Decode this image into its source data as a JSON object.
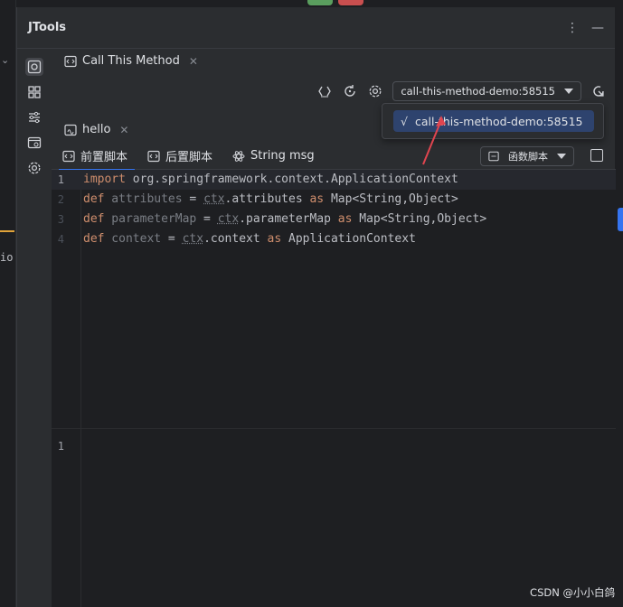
{
  "left_gutter": {
    "fragment": "io"
  },
  "tool_window": {
    "title": "JTools",
    "actions": {
      "more": "⋮",
      "minimize": "—"
    }
  },
  "tabs": {
    "call": {
      "label": "Call This Method"
    },
    "hello": {
      "label": "hello"
    }
  },
  "toolbar": {
    "connection_value": "call-this-method-demo:58515"
  },
  "popup": {
    "items": [
      {
        "label": "call-this-method-demo:58515",
        "check": "√"
      }
    ]
  },
  "subtabs": [
    {
      "label": "前置脚本"
    },
    {
      "label": "后置脚本"
    },
    {
      "label": "String msg"
    }
  ],
  "function_select": {
    "value": "函数脚本"
  },
  "editor": {
    "lines": [
      {
        "no": "1"
      },
      {
        "no": "2"
      },
      {
        "no": "3"
      },
      {
        "no": "4"
      }
    ],
    "tokens": {
      "import": "import",
      "import_target": " org.springframework.context.ApplicationContext",
      "def": "def",
      "attributes": " attributes",
      "parameterMap": " parameterMap",
      "context": " context",
      "eq": " = ",
      "ctx": "ctx",
      "dot_attributes": ".attributes ",
      "dot_parameterMap": ".parameterMap ",
      "dot_context": ".context ",
      "as": "as",
      "map_type": " Map<String,Object>",
      "app_ctx_type": " ApplicationContext"
    }
  },
  "editor2": {
    "line_no": "1"
  },
  "watermark": "CSDN @小小白鸽",
  "colors": {
    "accent": "#3574f0",
    "keyword": "#cf8e6d",
    "popup_selection": "#2e436e",
    "arrow": "#e0454f"
  }
}
